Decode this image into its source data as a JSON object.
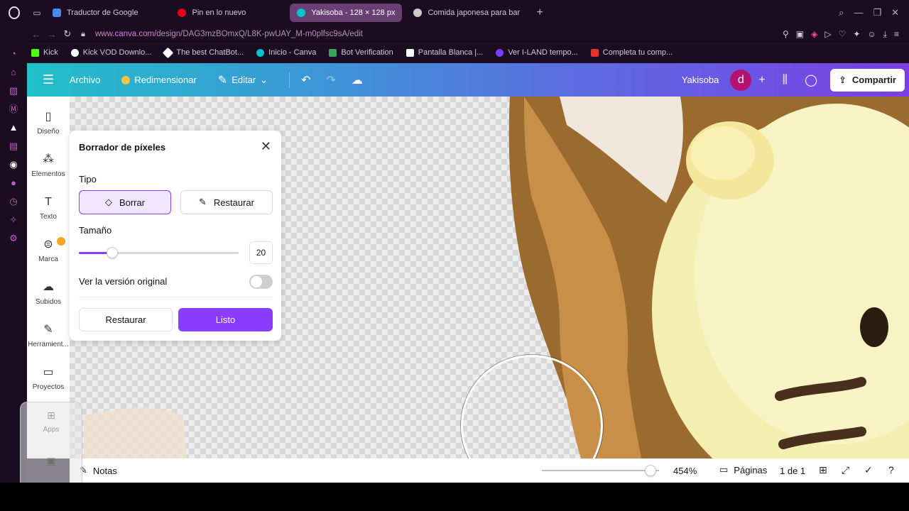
{
  "browser": {
    "tabs": [
      {
        "label": "Traductor de Google",
        "color": "#4a8af4",
        "active": false
      },
      {
        "label": "Pin en lo nuevo",
        "color": "#e60023",
        "active": false
      },
      {
        "label": "Yakisoba - 128 × 128 px",
        "color": "#00c4cc",
        "active": true
      },
      {
        "label": "Comida japonesa para bar",
        "color": "#cccccc",
        "active": false
      }
    ],
    "url_host": "www.canva.com",
    "url_path": "/design/DAG3mzBOmxQ/L8K-pwUAY_M-m0plfsc9sA/edit",
    "bookmarks": [
      {
        "label": "Kick",
        "color": "#53fc18"
      },
      {
        "label": "Kick VOD Downlo...",
        "color": "#ffffff"
      },
      {
        "label": "The best ChatBot...",
        "color": "#ffffff"
      },
      {
        "label": "Inicio - Canva",
        "color": "#00c4cc"
      },
      {
        "label": "Bot Verification",
        "color": "#3aa35b"
      },
      {
        "label": "Pantalla Blanca |...",
        "color": "#ffffff"
      },
      {
        "label": "Ver I-LAND tempo...",
        "color": "#7a3cff"
      },
      {
        "label": "Completa tu comp...",
        "color": "#e0332f"
      }
    ]
  },
  "header": {
    "archivo": "Archivo",
    "redimensionar": "Redimensionar",
    "editar": "Editar",
    "title": "Yakisoba",
    "avatar_letter": "d",
    "share": "Compartir"
  },
  "leftnav": [
    {
      "label": "Diseño",
      "icon": "layout-icon"
    },
    {
      "label": "Elementos",
      "icon": "shapes-icon"
    },
    {
      "label": "Texto",
      "icon": "text-icon"
    },
    {
      "label": "Marca",
      "icon": "brand-icon"
    },
    {
      "label": "Subidos",
      "icon": "cloud-upload-icon"
    },
    {
      "label": "Herramient...",
      "icon": "tools-icon"
    },
    {
      "label": "Proyectos",
      "icon": "folder-icon"
    }
  ],
  "apps_overlay": {
    "label": "Apps"
  },
  "panel": {
    "title": "Borrador de píxeles",
    "tipo_label": "Tipo",
    "erase": "Borrar",
    "restore_mode": "Restaurar",
    "size_label": "Tamaño",
    "size_value": "20",
    "size_fraction": 0.21,
    "original_label": "Ver la versión original",
    "original_on": false,
    "restore_btn": "Restaurar",
    "done_btn": "Listo"
  },
  "footer": {
    "notes": "Notas",
    "zoom": "454%",
    "zoom_fraction": 0.93,
    "pages": "Páginas",
    "page_count": "1 de 1"
  },
  "colors": {
    "accent": "#8b3dff",
    "avatar": "#b3126e"
  }
}
